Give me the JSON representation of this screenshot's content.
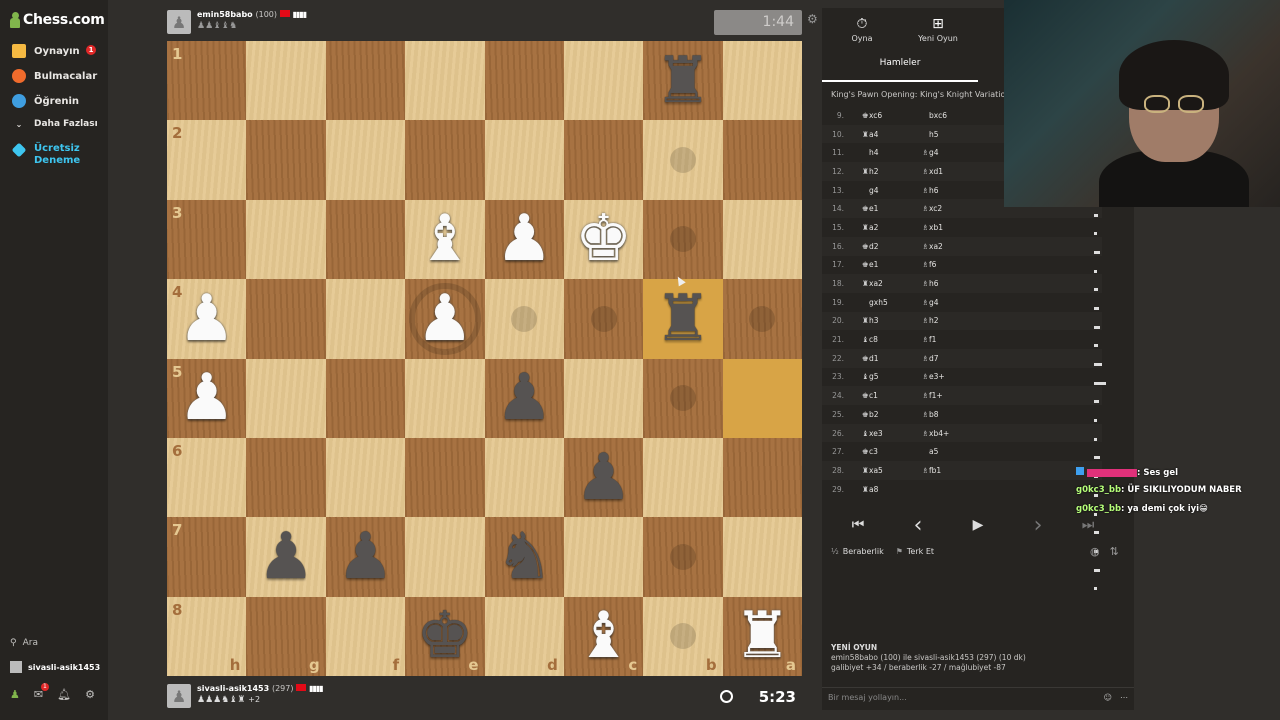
{
  "sidebar": {
    "logo": "Chess.com",
    "items": [
      {
        "label": "Oynayın",
        "badge": "1",
        "icon": "play-icon",
        "color": "#f5b942"
      },
      {
        "label": "Bulmacalar",
        "icon": "puzzle-icon",
        "color": "#f06b2c"
      },
      {
        "label": "Öğrenin",
        "icon": "learn-icon",
        "color": "#3f9ee0"
      },
      {
        "label": "Daha Fazlası",
        "icon": "chevron-down-icon"
      },
      {
        "label": "Ücretsiz Deneme",
        "icon": "diamond-icon",
        "color": "#3ec6f0"
      }
    ],
    "search": "Ara",
    "username": "sivasli-asik1453",
    "notif_badge": "1"
  },
  "top_player": {
    "name": "emin58babo",
    "rating": "(100)",
    "clock": "1:44",
    "captured": "♟♟♝♝♞"
  },
  "bottom_player": {
    "name": "sivasli-asik1453",
    "rating": "(297)",
    "clock": "5:23",
    "captured": "♟♟♟♞♝♜",
    "advantage": "+2"
  },
  "board": {
    "ranks": [
      "1",
      "2",
      "3",
      "4",
      "5",
      "6",
      "7",
      "8"
    ],
    "files": [
      "h",
      "g",
      "f",
      "e",
      "d",
      "c",
      "b",
      "a"
    ],
    "highlight_color": "#d8a446",
    "pieces": [
      {
        "sq": "b1",
        "piece": "♜",
        "color": "b"
      },
      {
        "sq": "e3",
        "piece": "♝",
        "color": "w"
      },
      {
        "sq": "d3",
        "piece": "♟",
        "color": "w"
      },
      {
        "sq": "c3",
        "piece": "♚",
        "color": "w"
      },
      {
        "sq": "h4",
        "piece": "♟",
        "color": "w"
      },
      {
        "sq": "e4",
        "piece": "♟",
        "color": "w"
      },
      {
        "sq": "b4",
        "piece": "♜",
        "color": "b"
      },
      {
        "sq": "h5",
        "piece": "♟",
        "color": "w"
      },
      {
        "sq": "d5",
        "piece": "♟",
        "color": "b"
      },
      {
        "sq": "c6",
        "piece": "♟",
        "color": "b"
      },
      {
        "sq": "g7",
        "piece": "♟",
        "color": "b"
      },
      {
        "sq": "f7",
        "piece": "♟",
        "color": "b"
      },
      {
        "sq": "d7",
        "piece": "♞",
        "color": "b"
      },
      {
        "sq": "e8",
        "piece": "♚",
        "color": "b"
      },
      {
        "sq": "c8",
        "piece": "♝",
        "color": "w"
      },
      {
        "sq": "a8",
        "piece": "♜",
        "color": "w"
      }
    ],
    "highlights": [
      "b4",
      "a5"
    ],
    "hints": [
      "b2",
      "b3",
      "d4",
      "c4",
      "a4",
      "b5",
      "b7",
      "b8"
    ],
    "capture_rings": [
      "e4"
    ]
  },
  "panel": {
    "tab_play": "Oyna",
    "tab_new": "Yeni Oyun",
    "subtab": "Hamleler",
    "opening": "King's Pawn Opening: King's Knight Variation",
    "moves": [
      {
        "n": "9.",
        "w": "xc6",
        "wi": "♚",
        "b": "bxc6",
        "bi": ""
      },
      {
        "n": "10.",
        "w": "a4",
        "wi": "♜",
        "b": "h5",
        "bi": ""
      },
      {
        "n": "11.",
        "w": "h4",
        "wi": "",
        "b": "g4",
        "bi": "♗"
      },
      {
        "n": "12.",
        "w": "h2",
        "wi": "♜",
        "b": "xd1",
        "bi": "♗"
      },
      {
        "n": "13.",
        "w": "g4",
        "wi": "",
        "b": "h6",
        "bi": "♗"
      },
      {
        "n": "14.",
        "w": "e1",
        "wi": "♚",
        "b": "xc2",
        "bi": "♗"
      },
      {
        "n": "15.",
        "w": "a2",
        "wi": "♜",
        "b": "xb1",
        "bi": "♗"
      },
      {
        "n": "16.",
        "w": "d2",
        "wi": "♚",
        "b": "xa2",
        "bi": "♗"
      },
      {
        "n": "17.",
        "w": "e1",
        "wi": "♚",
        "b": "f6",
        "bi": "♗"
      },
      {
        "n": "18.",
        "w": "xa2",
        "wi": "♜",
        "b": "h6",
        "bi": "♗"
      },
      {
        "n": "19.",
        "w": "gxh5",
        "wi": "",
        "b": "g4",
        "bi": "♗"
      },
      {
        "n": "20.",
        "w": "h3",
        "wi": "♜",
        "b": "h2",
        "bi": "♗"
      },
      {
        "n": "21.",
        "w": "c8",
        "wi": "♝",
        "b": "f1",
        "bi": "♗"
      },
      {
        "n": "22.",
        "w": "d1",
        "wi": "♚",
        "b": "d7",
        "bi": "♗"
      },
      {
        "n": "23.",
        "w": "g5",
        "wi": "♝",
        "b": "e3+",
        "bi": "♗"
      },
      {
        "n": "24.",
        "w": "c1",
        "wi": "♚",
        "b": "f1+",
        "bi": "♗"
      },
      {
        "n": "25.",
        "w": "b2",
        "wi": "♚",
        "b": "b8",
        "bi": "♗"
      },
      {
        "n": "26.",
        "w": "xe3",
        "wi": "♝",
        "b": "xb4+",
        "bi": "♗"
      },
      {
        "n": "27.",
        "w": "c3",
        "wi": "♚",
        "b": "a5",
        "bi": ""
      },
      {
        "n": "28.",
        "w": "xa5",
        "wi": "♜",
        "b": "fb1",
        "bi": "♗"
      },
      {
        "n": "29.",
        "w": "a8",
        "wi": "♜",
        "b": "",
        "bi": ""
      }
    ],
    "controls": [
      "⏮",
      "‹",
      "▶",
      "›",
      "⏭"
    ],
    "draw": "Beraberlik",
    "resign": "Terk Et",
    "new_game_title": "YENİ OYUN",
    "new_game_line1": "emin58babo (100) ile sivasli-asik1453 (297) (10 dk)",
    "new_game_line2": "galibiyet +34 / beraberlik -27 / mağlubiyet -87",
    "message_placeholder": "Bir mesaj yollayın..."
  },
  "chat": [
    {
      "user": "",
      "text": ": Ses gel"
    },
    {
      "user": "g0kc3_bb",
      "text": ": ÜF SIKILIYODUM NABER"
    },
    {
      "user": "g0kc3_bb",
      "text": ": ya demi çok iyi😁"
    }
  ]
}
